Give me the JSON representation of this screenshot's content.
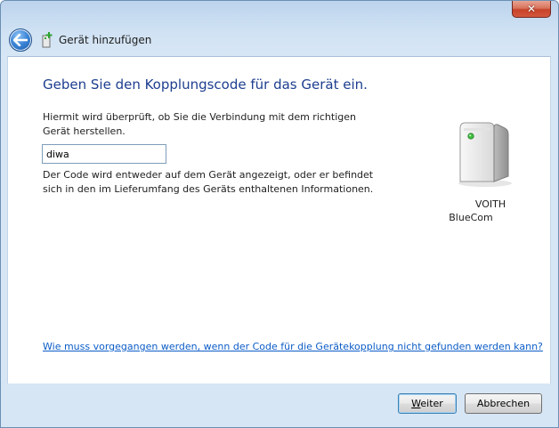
{
  "window": {
    "title": "Gerät hinzufügen",
    "close_glyph": "✕"
  },
  "main": {
    "heading": "Geben Sie den Kopplungscode für das Gerät ein.",
    "description": "Hiermit wird überprüft, ob Sie die Verbindung mit dem richtigen Gerät herstellen.",
    "code_value": "diwa",
    "hint": "Der Code wird entweder auf dem Gerät angezeigt, oder er befindet sich in den im Lieferumfang des Geräts enthaltenen Informationen.",
    "help_link": "Wie muss vorgegangen werden, wenn der Code für die Gerätekopplung nicht gefunden werden kann?"
  },
  "device": {
    "name_line1": "VOITH",
    "name_line2": "BlueCom",
    "icon": "computer-tower-icon"
  },
  "footer": {
    "next_accel": "W",
    "next_rest": "eiter",
    "cancel_label": "Abbrechen"
  },
  "colors": {
    "heading": "#1d3e8f",
    "link": "#0b5cc7",
    "frame": "#d7e6f5"
  }
}
